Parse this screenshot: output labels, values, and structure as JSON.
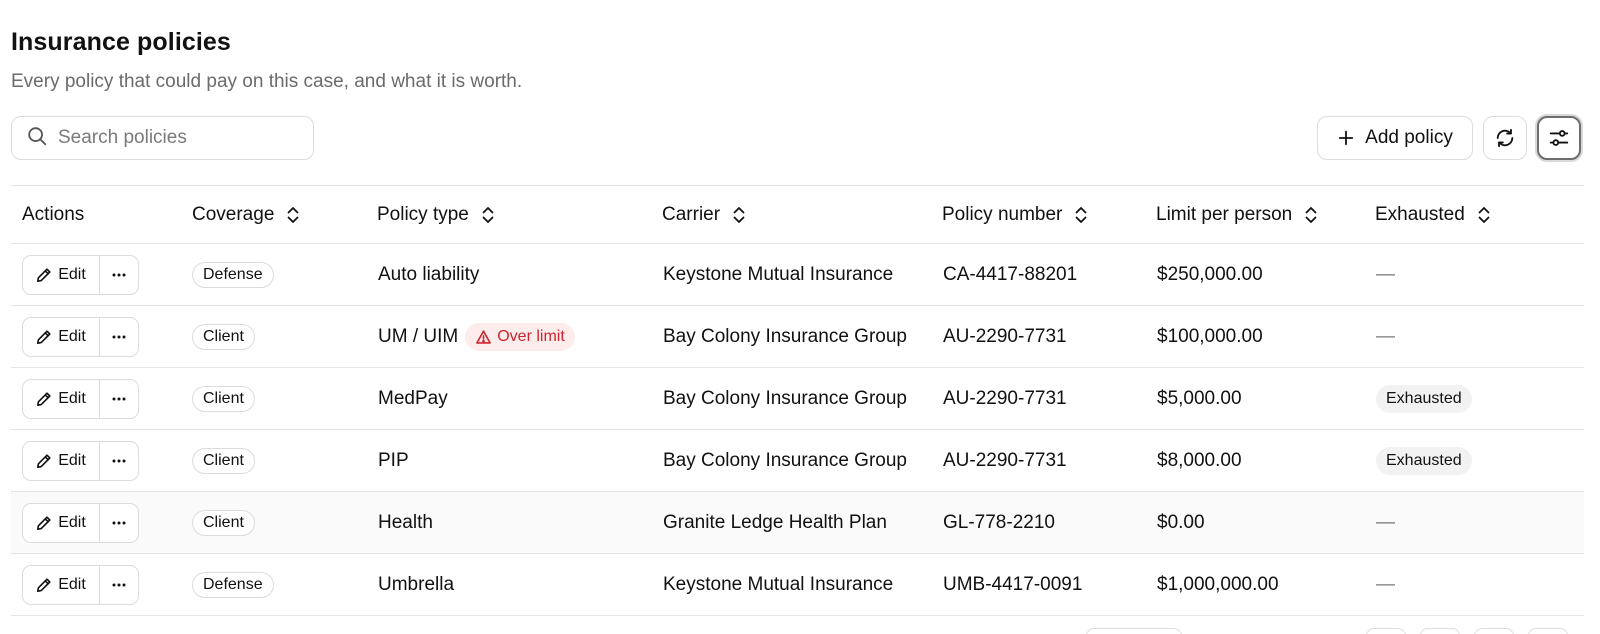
{
  "header": {
    "title": "Insurance policies",
    "subtitle": "Every policy that could pay on this case, and what it is worth."
  },
  "search": {
    "placeholder": "Search policies",
    "value": ""
  },
  "toolbar": {
    "add_label": "Add policy"
  },
  "table": {
    "columns": {
      "actions": "Actions",
      "coverage": "Coverage",
      "policy_type": "Policy type",
      "carrier": "Carrier",
      "policy_number": "Policy number",
      "limit": "Limit per person",
      "exhausted": "Exhausted"
    },
    "edit_label": "Edit",
    "rows": [
      {
        "coverage": "Defense",
        "policy_type": "Auto liability",
        "flag": "",
        "carrier": "Keystone Mutual Insurance",
        "policy_number": "CA-4417-88201",
        "limit": "$250,000.00",
        "exhausted": "—"
      },
      {
        "coverage": "Client",
        "policy_type": "UM / UIM",
        "flag": "Over limit",
        "carrier": "Bay Colony Insurance Group",
        "policy_number": "AU-2290-7731",
        "limit": "$100,000.00",
        "exhausted": "—"
      },
      {
        "coverage": "Client",
        "policy_type": "MedPay",
        "flag": "",
        "carrier": "Bay Colony Insurance Group",
        "policy_number": "AU-2290-7731",
        "limit": "$5,000.00",
        "exhausted": "Exhausted"
      },
      {
        "coverage": "Client",
        "policy_type": "PIP",
        "flag": "",
        "carrier": "Bay Colony Insurance Group",
        "policy_number": "AU-2290-7731",
        "limit": "$8,000.00",
        "exhausted": "Exhausted"
      },
      {
        "coverage": "Client",
        "policy_type": "Health",
        "flag": "",
        "carrier": "Granite Ledge Health Plan",
        "policy_number": "GL-778-2210",
        "limit": "$0.00",
        "exhausted": "—"
      },
      {
        "coverage": "Defense",
        "policy_type": "Umbrella",
        "flag": "",
        "carrier": "Keystone Mutual Insurance",
        "policy_number": "UMB-4417-0091",
        "limit": "$1,000,000.00",
        "exhausted": "—"
      }
    ]
  },
  "icons": {
    "search": "search-icon",
    "add": "plus-icon",
    "refresh": "refresh-icon",
    "settings": "sliders-icon",
    "sort": "sort-icon",
    "edit": "pencil-icon",
    "more": "more-icon",
    "warning": "warning-icon"
  },
  "colors": {
    "danger_text": "#d1242f",
    "danger_bg": "#fdecec",
    "muted_bg": "#f2f2f2",
    "border": "#dcdcdc"
  }
}
